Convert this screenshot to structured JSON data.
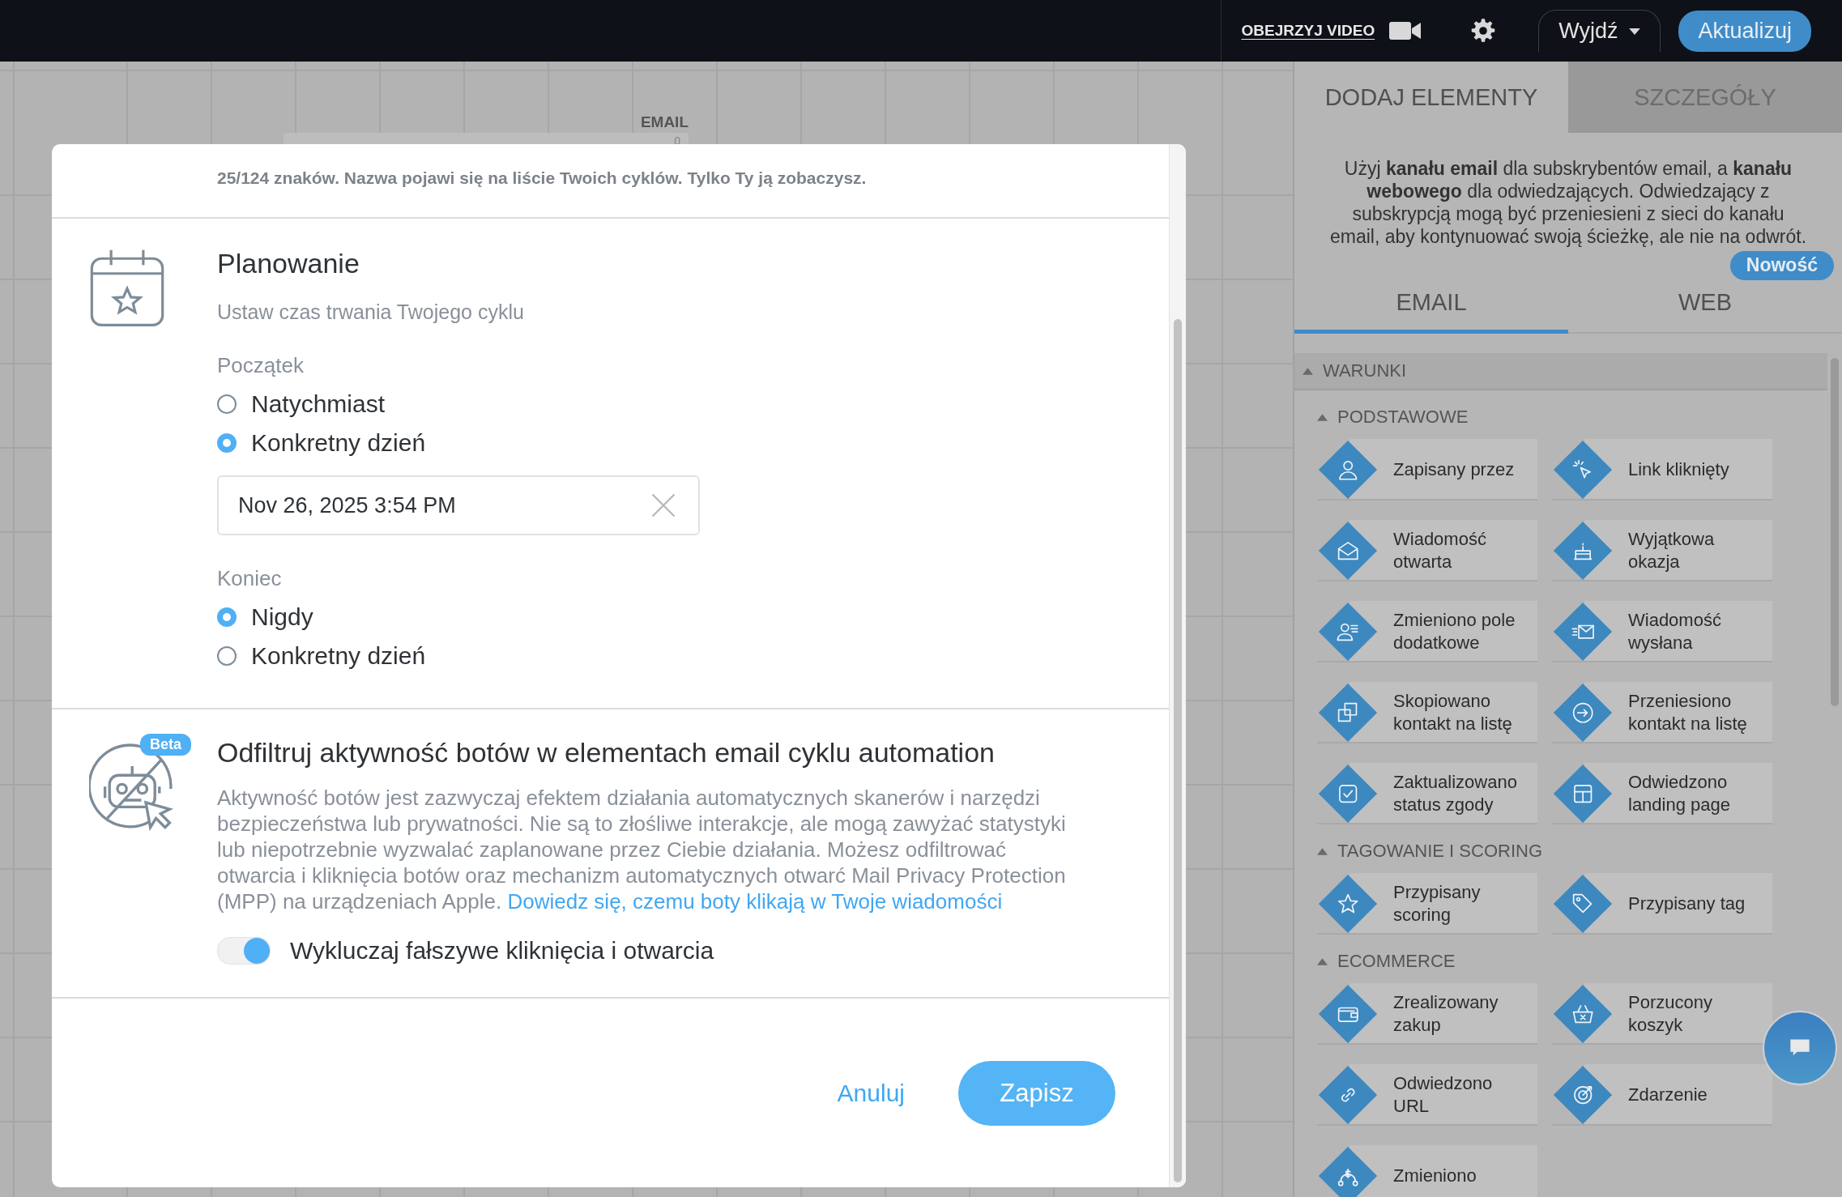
{
  "topbar": {
    "watch_video": "OBEJRZYJ VIDEO",
    "exit": "Wyjdź",
    "update": "Aktualizuj"
  },
  "canvas": {
    "label": "EMAIL",
    "count": "0"
  },
  "modal": {
    "name_hint": "25/124 znaków. Nazwa pojawi się na liście Twoich cyklów. Tylko Ty ją zobaczysz.",
    "scheduling": {
      "title": "Planowanie",
      "subtitle": "Ustaw czas trwania Twojego cyklu",
      "start": {
        "label": "Początek",
        "options": [
          {
            "label": "Natychmiast",
            "selected": false
          },
          {
            "label": "Konkretny dzień",
            "selected": true
          }
        ]
      },
      "date_value": "Nov 26, 2025 3:54 PM",
      "end": {
        "label": "Koniec",
        "options": [
          {
            "label": "Nigdy",
            "selected": true
          },
          {
            "label": "Konkretny dzień",
            "selected": false
          }
        ]
      }
    },
    "bot_filter": {
      "badge": "Beta",
      "title": "Odfiltruj aktywność botów w elementach email cyklu automation",
      "description": "Aktywność botów jest zazwyczaj efektem działania automatycznych skanerów i narzędzi bezpieczeństwa lub prywatności. Nie są to złośliwe interakcje, ale mogą zawyżać statystyki lub niepotrzebnie wyzwalać zaplanowane przez Ciebie działania. Możesz odfiltrować otwarcia i kliknięcia botów oraz mechanizm automatycznych otwarć Mail Privacy Protection (MPP) na urządzeniach Apple.",
      "link": "Dowiedz się, czemu boty klikają w Twoje wiadomości",
      "toggle": {
        "label": "Wykluczaj fałszywe kliknięcia i otwarcia",
        "on": true
      }
    },
    "cancel": "Anuluj",
    "save": "Zapisz"
  },
  "sidebar": {
    "tabs": [
      {
        "label": "DODAJ ELEMENTY",
        "selected": true
      },
      {
        "label": "SZCZEGÓŁY",
        "selected": false
      }
    ],
    "info": "Użyj **kanału email** dla subskrybentów email, a **kanału webowego** dla odwiedzających. Odwiedzający z subskrypcją mogą być przeniesieni z sieci do kanału email, aby kontynuować swoją ścieżkę, ale nie na odwrót.",
    "new_badge": "Nowość",
    "channel_tabs": [
      {
        "label": "EMAIL",
        "selected": true
      },
      {
        "label": "WEB",
        "selected": false
      }
    ],
    "section": "WARUNKI",
    "groups": [
      {
        "title": "PODSTAWOWE",
        "items": [
          {
            "label": "Zapisany przez"
          },
          {
            "label": "Link kliknięty"
          },
          {
            "label": "Wiadomość otwarta"
          },
          {
            "label": "Wyjątkowa okazja"
          },
          {
            "label": "Zmieniono pole dodatkowe"
          },
          {
            "label": "Wiadomość wysłana"
          },
          {
            "label": "Skopiowano kontakt na listę"
          },
          {
            "label": "Przeniesiono kontakt na listę"
          },
          {
            "label": "Zaktualizowano status zgody"
          },
          {
            "label": "Odwiedzono landing page"
          }
        ]
      },
      {
        "title": "TAGOWANIE I SCORING",
        "items": [
          {
            "label": "Przypisany scoring"
          },
          {
            "label": "Przypisany tag"
          }
        ]
      },
      {
        "title": "ECOMMERCE",
        "items": [
          {
            "label": "Zrealizowany zakup"
          },
          {
            "label": "Porzucony koszyk"
          },
          {
            "label": "Odwiedzono URL"
          },
          {
            "label": "Zdarzenie"
          },
          {
            "label": "Zmieniono"
          }
        ]
      }
    ]
  }
}
